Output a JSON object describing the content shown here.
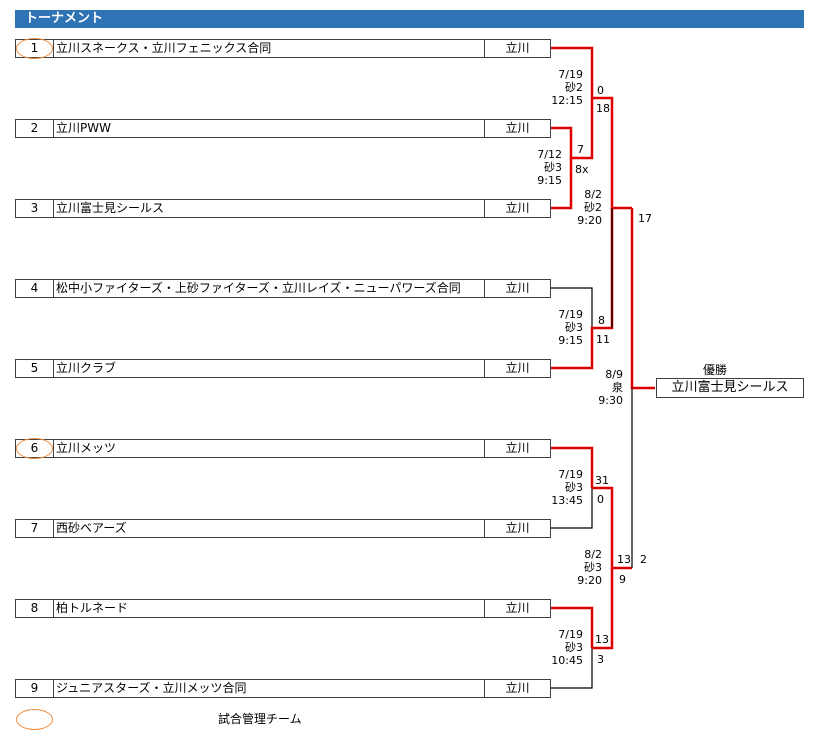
{
  "title": "トーナメント",
  "teams": [
    {
      "num": "1",
      "name": "立川スネークス・立川フェニックス合同",
      "region": "立川"
    },
    {
      "num": "2",
      "name": "立川PWW",
      "region": "立川"
    },
    {
      "num": "3",
      "name": "立川富士見シールス",
      "region": "立川"
    },
    {
      "num": "4",
      "name": "松中小ファイターズ・上砂ファイターズ・立川レイズ・ニューパワーズ合同",
      "region": "立川"
    },
    {
      "num": "5",
      "name": "立川クラブ",
      "region": "立川"
    },
    {
      "num": "6",
      "name": "立川メッツ",
      "region": "立川"
    },
    {
      "num": "7",
      "name": "西砂ベアーズ",
      "region": "立川"
    },
    {
      "num": "8",
      "name": "柏トルネード",
      "region": "立川"
    },
    {
      "num": "9",
      "name": "ジュニアスターズ・立川メッツ合同",
      "region": "立川"
    }
  ],
  "matches": {
    "m_2_3": {
      "date": "7/12",
      "venue": "砂3",
      "time": "9:15",
      "score_a": "7",
      "score_b": "8x"
    },
    "m_1_23": {
      "date": "7/19",
      "venue": "砂2",
      "time": "12:15",
      "score_a": "0",
      "score_b": "18"
    },
    "m_4_5": {
      "date": "7/19",
      "venue": "砂3",
      "time": "9:15",
      "score_a": "8",
      "score_b": "11"
    },
    "m_top_semi": {
      "date": "8/2",
      "venue": "砂2",
      "time": "9:20",
      "score_a": "17",
      "score_b": ""
    },
    "m_6_7": {
      "date": "7/19",
      "venue": "砂3",
      "time": "13:45",
      "score_a": "31",
      "score_b": "0"
    },
    "m_8_9": {
      "date": "7/19",
      "venue": "砂3",
      "time": "10:45",
      "score_a": "13",
      "score_b": "3"
    },
    "m_bottom_semi": {
      "date": "8/2",
      "venue": "砂3",
      "time": "9:20",
      "score_a": "13",
      "score_b": "9"
    },
    "final": {
      "date": "8/9",
      "venue": "泉",
      "time": "9:30",
      "score_a": "17",
      "score_b": "2"
    }
  },
  "winner": {
    "label": "優勝",
    "team": "立川富士見シールス"
  },
  "legend": {
    "text": "試合管理チーム"
  },
  "colors": {
    "header_bg": "#2e74b5",
    "win_line": "#e00000",
    "line": "#000000",
    "oval": "#ee8a3a"
  }
}
